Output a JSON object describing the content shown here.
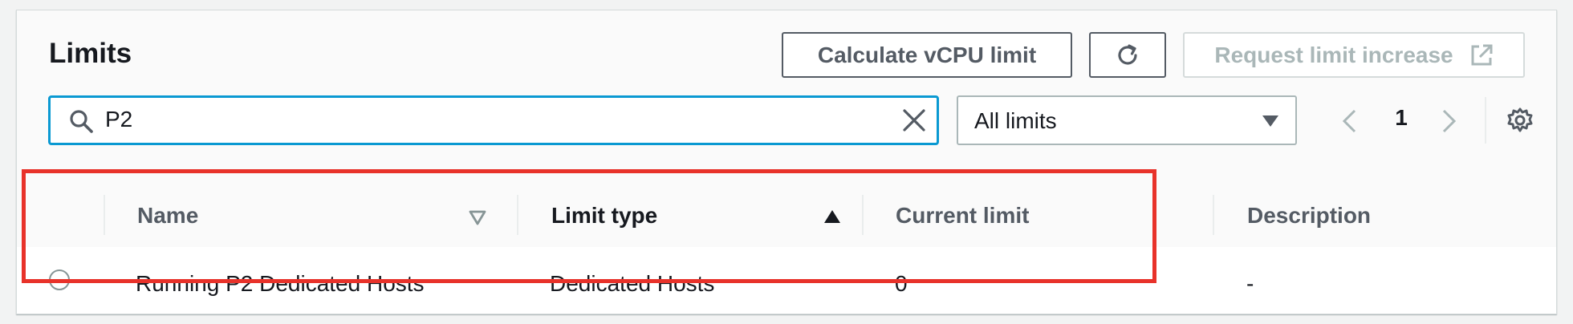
{
  "header": {
    "title": "Limits",
    "calculate_label": "Calculate vCPU limit",
    "request_label": "Request limit increase"
  },
  "search": {
    "value": "P2"
  },
  "filter": {
    "selected": "All limits"
  },
  "pagination": {
    "current_page": "1"
  },
  "table": {
    "columns": [
      "Name",
      "Limit type",
      "Current limit",
      "Description"
    ],
    "sorted_column": "Limit type",
    "sort_direction": "ascending",
    "rows": [
      {
        "name": "Running P2 Dedicated Hosts",
        "limit_type": "Dedicated Hosts",
        "current_limit": "0",
        "description": "-"
      }
    ]
  },
  "colors": {
    "focus_border": "#0a99d2",
    "highlight": "#e8322a",
    "disabled_text": "#aab7b8"
  },
  "icons": [
    "search-icon",
    "clear-icon",
    "refresh-icon",
    "external-link-icon",
    "caret-down-icon",
    "chevron-left-icon",
    "chevron-right-icon",
    "gear-icon",
    "sort-filter-icon",
    "sort-ascending-icon"
  ]
}
